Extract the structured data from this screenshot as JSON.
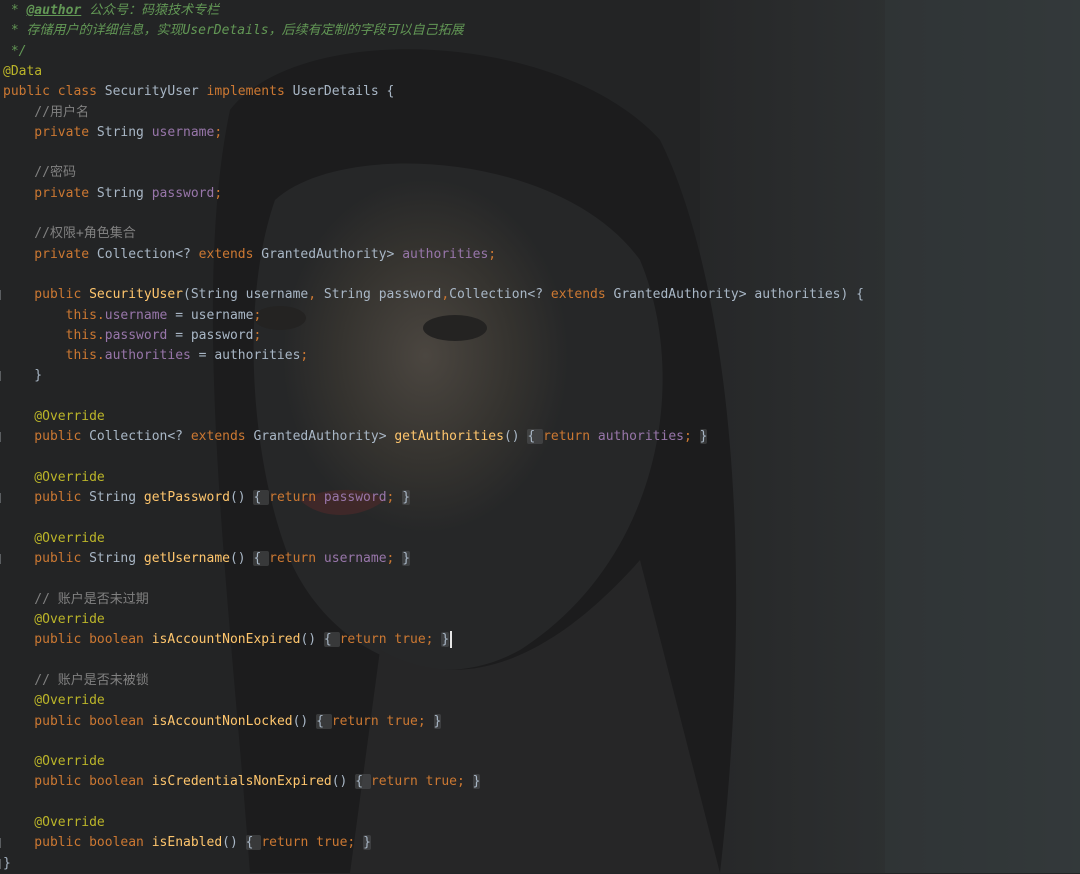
{
  "editor": {
    "language": "java",
    "theme_colors": {
      "keyword": "#cc7832",
      "field": "#9876aa",
      "method": "#ffc66d",
      "annotation": "#bbb529",
      "comment": "#808080",
      "doc_comment": "#629755",
      "plain": "#a9b7c6"
    },
    "background": "dark portrait wallpaper of a woman with long dark hair"
  },
  "lines": [
    {
      "tokens": [
        {
          "c": "doc",
          "t": " * "
        },
        {
          "c": "doctag",
          "t": "@author"
        },
        {
          "c": "doc",
          "t": " 公众号：码猿技术专栏"
        }
      ]
    },
    {
      "tokens": [
        {
          "c": "doc",
          "t": " * 存储用户的详细信息，实现UserDetails，后续有定制的字段可以自己拓展"
        }
      ]
    },
    {
      "tokens": [
        {
          "c": "doc",
          "t": " */"
        }
      ]
    },
    {
      "tokens": [
        {
          "c": "ann",
          "t": "@Data"
        }
      ]
    },
    {
      "tokens": [
        {
          "c": "kw",
          "t": "public class "
        },
        {
          "c": "plain",
          "t": "SecurityUser "
        },
        {
          "c": "kw",
          "t": "implements "
        },
        {
          "c": "plain",
          "t": "UserDetails {"
        }
      ]
    },
    {
      "tokens": [
        {
          "c": "cmt",
          "t": "    //用户名"
        }
      ]
    },
    {
      "tokens": [
        {
          "c": "kw",
          "t": "    private "
        },
        {
          "c": "plain",
          "t": "String "
        },
        {
          "c": "fld",
          "t": "username"
        },
        {
          "c": "kw",
          "t": ";"
        }
      ]
    },
    {
      "tokens": []
    },
    {
      "tokens": [
        {
          "c": "cmt",
          "t": "    //密码"
        }
      ]
    },
    {
      "tokens": [
        {
          "c": "kw",
          "t": "    private "
        },
        {
          "c": "plain",
          "t": "String "
        },
        {
          "c": "fld",
          "t": "password"
        },
        {
          "c": "kw",
          "t": ";"
        }
      ]
    },
    {
      "tokens": []
    },
    {
      "tokens": [
        {
          "c": "cmt",
          "t": "    //权限+角色集合"
        }
      ]
    },
    {
      "tokens": [
        {
          "c": "kw",
          "t": "    private "
        },
        {
          "c": "plain",
          "t": "Collection<? "
        },
        {
          "c": "kw",
          "t": "extends "
        },
        {
          "c": "plain",
          "t": "GrantedAuthority> "
        },
        {
          "c": "fld",
          "t": "authorities"
        },
        {
          "c": "kw",
          "t": ";"
        }
      ]
    },
    {
      "tokens": []
    },
    {
      "gutter": true,
      "tokens": [
        {
          "c": "kw",
          "t": "    public "
        },
        {
          "c": "fn",
          "t": "SecurityUser"
        },
        {
          "c": "plain",
          "t": "(String username"
        },
        {
          "c": "kw",
          "t": ", "
        },
        {
          "c": "plain",
          "t": "String password"
        },
        {
          "c": "kw",
          "t": ","
        },
        {
          "c": "plain",
          "t": "Collection<? "
        },
        {
          "c": "kw",
          "t": "extends "
        },
        {
          "c": "plain",
          "t": "GrantedAuthority> authorities) {"
        }
      ]
    },
    {
      "tokens": [
        {
          "c": "kw",
          "t": "        this."
        },
        {
          "c": "fld",
          "t": "username"
        },
        {
          "c": "plain",
          "t": " = username"
        },
        {
          "c": "kw",
          "t": ";"
        }
      ]
    },
    {
      "tokens": [
        {
          "c": "kw",
          "t": "        this."
        },
        {
          "c": "fld",
          "t": "password"
        },
        {
          "c": "plain",
          "t": " = password"
        },
        {
          "c": "kw",
          "t": ";"
        }
      ]
    },
    {
      "tokens": [
        {
          "c": "kw",
          "t": "        this."
        },
        {
          "c": "fld",
          "t": "authorities"
        },
        {
          "c": "plain",
          "t": " = authorities"
        },
        {
          "c": "kw",
          "t": ";"
        }
      ]
    },
    {
      "gutter": true,
      "tokens": [
        {
          "c": "plain",
          "t": "    }"
        }
      ]
    },
    {
      "tokens": []
    },
    {
      "tokens": [
        {
          "c": "ann",
          "t": "    @Override"
        }
      ]
    },
    {
      "gutter": true,
      "tokens": [
        {
          "c": "kw",
          "t": "    public "
        },
        {
          "c": "plain",
          "t": "Collection<? "
        },
        {
          "c": "kw",
          "t": "extends "
        },
        {
          "c": "plain",
          "t": "GrantedAuthority> "
        },
        {
          "c": "fn",
          "t": "getAuthorities"
        },
        {
          "c": "plain",
          "t": "() "
        },
        {
          "c": "fold",
          "t": "{ "
        },
        {
          "c": "kw",
          "t": "return "
        },
        {
          "c": "fld",
          "t": "authorities"
        },
        {
          "c": "kw",
          "t": "; "
        },
        {
          "c": "fold",
          "t": "}"
        }
      ]
    },
    {
      "tokens": []
    },
    {
      "tokens": [
        {
          "c": "ann",
          "t": "    @Override"
        }
      ]
    },
    {
      "gutter": true,
      "tokens": [
        {
          "c": "kw",
          "t": "    public "
        },
        {
          "c": "plain",
          "t": "String "
        },
        {
          "c": "fn",
          "t": "getPassword"
        },
        {
          "c": "plain",
          "t": "() "
        },
        {
          "c": "fold",
          "t": "{ "
        },
        {
          "c": "kw",
          "t": "return "
        },
        {
          "c": "fld",
          "t": "password"
        },
        {
          "c": "kw",
          "t": "; "
        },
        {
          "c": "fold",
          "t": "}"
        }
      ]
    },
    {
      "tokens": []
    },
    {
      "tokens": [
        {
          "c": "ann",
          "t": "    @Override"
        }
      ]
    },
    {
      "gutter": true,
      "tokens": [
        {
          "c": "kw",
          "t": "    public "
        },
        {
          "c": "plain",
          "t": "String "
        },
        {
          "c": "fn",
          "t": "getUsername"
        },
        {
          "c": "plain",
          "t": "() "
        },
        {
          "c": "fold",
          "t": "{ "
        },
        {
          "c": "kw",
          "t": "return "
        },
        {
          "c": "fld",
          "t": "username"
        },
        {
          "c": "kw",
          "t": "; "
        },
        {
          "c": "fold",
          "t": "}"
        }
      ]
    },
    {
      "tokens": []
    },
    {
      "tokens": [
        {
          "c": "cmt",
          "t": "    // 账户是否未过期"
        }
      ]
    },
    {
      "tokens": [
        {
          "c": "ann",
          "t": "    @Override"
        }
      ]
    },
    {
      "caret": true,
      "tokens": [
        {
          "c": "kw",
          "t": "    public boolean "
        },
        {
          "c": "fn",
          "t": "isAccountNonExpired"
        },
        {
          "c": "plain",
          "t": "() "
        },
        {
          "c": "fold",
          "t": "{ "
        },
        {
          "c": "kw",
          "t": "return true; "
        },
        {
          "c": "fold",
          "t": "}"
        }
      ]
    },
    {
      "tokens": []
    },
    {
      "tokens": [
        {
          "c": "cmt",
          "t": "    // 账户是否未被锁"
        }
      ]
    },
    {
      "tokens": [
        {
          "c": "ann",
          "t": "    @Override"
        }
      ]
    },
    {
      "tokens": [
        {
          "c": "kw",
          "t": "    public boolean "
        },
        {
          "c": "fn",
          "t": "isAccountNonLocked"
        },
        {
          "c": "plain",
          "t": "() "
        },
        {
          "c": "fold",
          "t": "{ "
        },
        {
          "c": "kw",
          "t": "return true; "
        },
        {
          "c": "fold",
          "t": "}"
        }
      ]
    },
    {
      "tokens": []
    },
    {
      "tokens": [
        {
          "c": "ann",
          "t": "    @Override"
        }
      ]
    },
    {
      "tokens": [
        {
          "c": "kw",
          "t": "    public boolean "
        },
        {
          "c": "fn",
          "t": "isCredentialsNonExpired"
        },
        {
          "c": "plain",
          "t": "() "
        },
        {
          "c": "fold",
          "t": "{ "
        },
        {
          "c": "kw",
          "t": "return true; "
        },
        {
          "c": "fold",
          "t": "}"
        }
      ]
    },
    {
      "tokens": []
    },
    {
      "tokens": [
        {
          "c": "ann",
          "t": "    @Override"
        }
      ]
    },
    {
      "gutter": true,
      "tokens": [
        {
          "c": "kw",
          "t": "    public boolean "
        },
        {
          "c": "fn",
          "t": "isEnabled"
        },
        {
          "c": "plain",
          "t": "() "
        },
        {
          "c": "fold",
          "t": "{ "
        },
        {
          "c": "kw",
          "t": "return true; "
        },
        {
          "c": "fold",
          "t": "}"
        }
      ]
    },
    {
      "gutter": true,
      "tokens": [
        {
          "c": "plain",
          "t": "}"
        }
      ]
    }
  ]
}
